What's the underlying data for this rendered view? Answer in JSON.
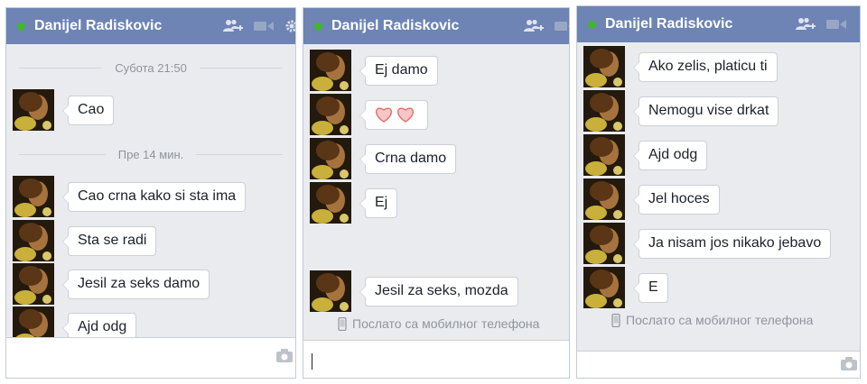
{
  "chat_panels": [
    {
      "title": "Danijel Radiskovic",
      "dividers": [
        "Субота 21:50",
        "Пре 14 мин."
      ],
      "messages": [
        "Cao",
        "Cao crna kako si sta ima",
        "Sta se radi",
        "Jesil za seks damo",
        "Ajd odg"
      ],
      "composer_value": ""
    },
    {
      "title": "Danijel Radiskovic",
      "messages": [
        "Ej damo",
        "",
        "Crna damo",
        "Ej",
        "Jesil za seks, mozda"
      ],
      "sent_note": "Послато са мобилног телефона",
      "composer_value": ""
    },
    {
      "title": "Danijel Radiskovic",
      "messages": [
        "Ako zelis, platicu ti",
        "Nemogu vise drkat",
        "Ajd odg",
        "Jel hoces",
        "Ja nisam jos nikako jebavo",
        "E"
      ],
      "sent_note": "Послато са мобилног телефона",
      "composer_value": ""
    }
  ],
  "icons": {
    "status": "online-dot-icon",
    "add_friend": "add-friend-icon",
    "video": "video-call-icon",
    "settings": "gear-icon",
    "heart": "heart-icon",
    "phone": "mobile-phone-icon",
    "camera": "camera-icon"
  },
  "colors": {
    "header": "#6d84b4",
    "online": "#42b72a",
    "chat_background": "#e9ebee",
    "bubble": "#ffffff",
    "heart": "#f28b8b",
    "meta_text": "#90949c"
  }
}
